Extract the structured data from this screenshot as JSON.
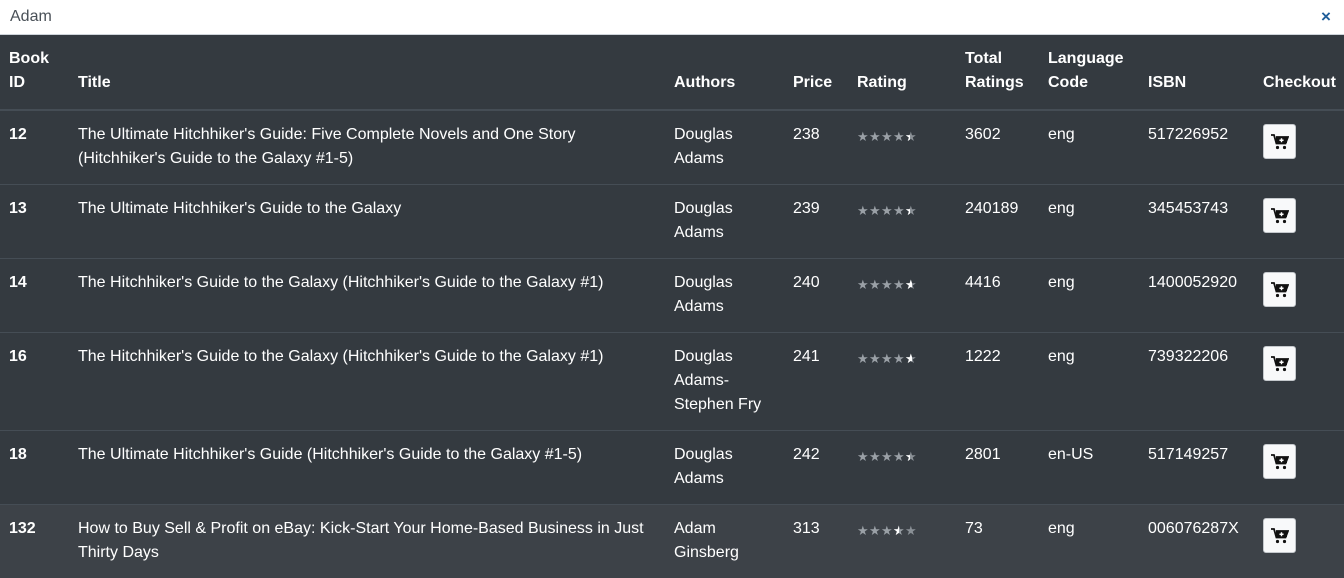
{
  "search": {
    "value": "Adam",
    "clear_label": "×"
  },
  "table": {
    "headers": [
      "Book ID",
      "Title",
      "Authors",
      "Price",
      "Rating",
      "Total Ratings",
      "Language Code",
      "ISBN",
      "Checkout"
    ],
    "rows": [
      {
        "id": "12",
        "title": "The Ultimate Hitchhiker's Guide: Five Complete Novels and One Story (Hitchhiker's Guide to the Galaxy #1-5)",
        "authors": "Douglas Adams",
        "price": "238",
        "rating": 4.4,
        "total": "3602",
        "lang": "eng",
        "isbn": "517226952"
      },
      {
        "id": "13",
        "title": "The Ultimate Hitchhiker's Guide to the Galaxy",
        "authors": "Douglas Adams",
        "price": "239",
        "rating": 4.4,
        "total": "240189",
        "lang": "eng",
        "isbn": "345453743"
      },
      {
        "id": "14",
        "title": "The Hitchhiker's Guide to the Galaxy (Hitchhiker's Guide to the Galaxy #1)",
        "authors": "Douglas Adams",
        "price": "240",
        "rating": 4.6,
        "total": "4416",
        "lang": "eng",
        "isbn": "1400052920"
      },
      {
        "id": "16",
        "title": "The Hitchhiker's Guide to the Galaxy (Hitchhiker's Guide to the Galaxy #1)",
        "authors": "Douglas Adams-Stephen Fry",
        "price": "241",
        "rating": 4.6,
        "total": "1222",
        "lang": "eng",
        "isbn": "739322206"
      },
      {
        "id": "18",
        "title": "The Ultimate Hitchhiker's Guide (Hitchhiker's Guide to the Galaxy #1-5)",
        "authors": "Douglas Adams",
        "price": "242",
        "rating": 4.4,
        "total": "2801",
        "lang": "en-US",
        "isbn": "517149257"
      },
      {
        "id": "132",
        "title": "How to Buy Sell & Profit on eBay: Kick-Start Your Home-Based Business in Just Thirty Days",
        "authors": "Adam Ginsberg",
        "price": "313",
        "rating": 3.5,
        "total": "73",
        "lang": "eng",
        "isbn": "006076287X"
      }
    ]
  },
  "icons": {
    "clear": "close-icon",
    "checkout": "cart-plus-icon",
    "rating": "star-icon"
  },
  "colors": {
    "table_bg": "#343a40",
    "hover_row_bg": "#3d4248",
    "clear_icon": "#1f5d99",
    "button_bg": "#f8f9fa"
  }
}
